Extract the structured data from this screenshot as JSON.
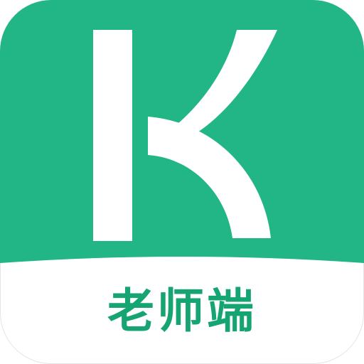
{
  "icon": {
    "caption": "老师端",
    "logo_icon": "letter-k-logo-icon",
    "colors": {
      "brand_green": "#22b585",
      "caption_green": "#16a572",
      "letter": "#ffffff",
      "bottom_panel": "#ffffff"
    }
  }
}
